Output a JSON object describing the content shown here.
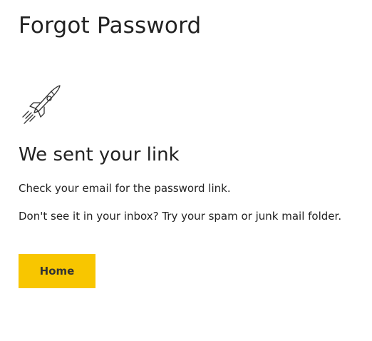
{
  "page": {
    "title": "Forgot Password"
  },
  "confirmation": {
    "icon": "rocket-icon",
    "heading": "We sent your link",
    "message_1": "Check your email for the password link.",
    "message_2": "Don't see it in your inbox? Try your spam or junk mail folder."
  },
  "actions": {
    "home_label": "Home"
  },
  "colors": {
    "button_background": "#f8c600",
    "text": "#222222",
    "background": "#ffffff"
  }
}
